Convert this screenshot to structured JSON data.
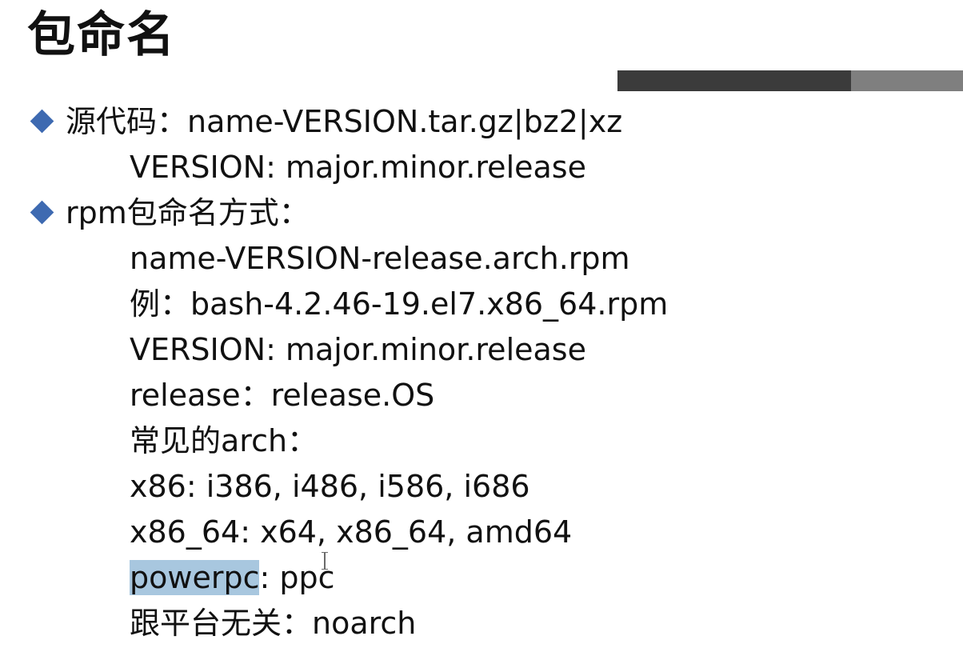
{
  "title": "包命名",
  "colors": {
    "bullet": "#3e6ab1",
    "bar_dark": "#3b3b3b",
    "bar_light": "#7f7f7f",
    "highlight": "#a8c7df"
  },
  "source_code": {
    "label": "源代码：name-VERSION.tar.gz|bz2|xz",
    "version": "VERSION: major.minor.release"
  },
  "rpm": {
    "label": "rpm包命名方式：",
    "format": "name-VERSION-release.arch.rpm",
    "example": "例：bash-4.2.46-19.el7.x86_64.rpm",
    "version": "VERSION: major.minor.release",
    "release": "release：release.OS",
    "arch_heading": "常见的arch：",
    "arch_x86": "x86: i386, i486, i586, i686",
    "arch_x86_64": "x86_64: x64, x86_64, amd64",
    "arch_powerpc_term": "powerpc",
    "arch_powerpc_rest": ": ppc",
    "arch_noarch": "跟平台无关：noarch"
  }
}
